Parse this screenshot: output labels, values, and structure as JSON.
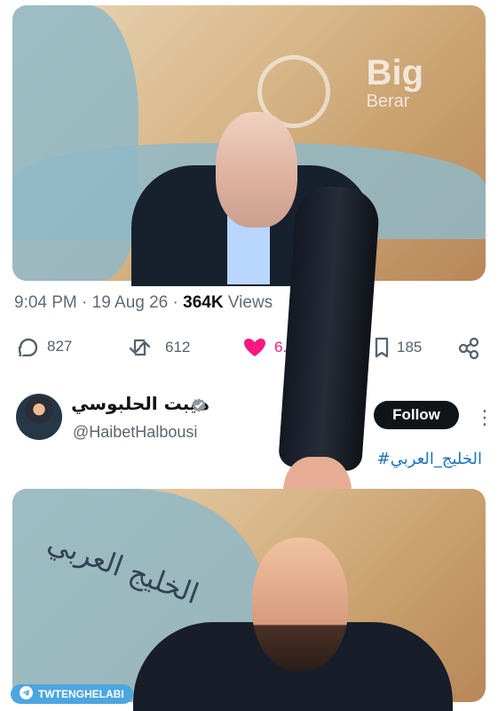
{
  "watermark": {
    "brand_top": "Big",
    "brand_bottom": "Berar"
  },
  "tweet": {
    "time": "9:04 PM",
    "separator": " · ",
    "date": "19 Aug 26",
    "views_value": "364K",
    "views_label": "Views",
    "replies": "827",
    "reposts": "612",
    "likes": "6.1K",
    "bookmarks": "185"
  },
  "author": {
    "name": "هيبت الحلبوسي",
    "handle": "@HaibetHalbousi",
    "follow_label": "Follow"
  },
  "hashtag": "#الخليج_العربي",
  "bottom_map_text": "الخليج العربي",
  "source_badge": "TWTENGHELABI",
  "colors": {
    "link": "#1d74b9",
    "like": "#f91880",
    "text_secondary": "#606b76",
    "follow_button": "#0f1419"
  },
  "icons": {
    "reply": "reply-icon",
    "repost": "repost-icon",
    "like": "heart-icon",
    "bookmark": "bookmark-icon",
    "share": "share-icon",
    "verified": "verified-icon",
    "more": "more-icon",
    "telegram": "telegram-icon"
  }
}
